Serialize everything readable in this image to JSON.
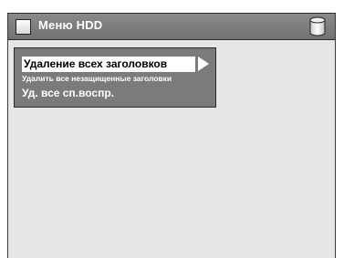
{
  "header": {
    "title": "Меню HDD",
    "left_icon": "menu-icon",
    "right_icon": "hdd-icon"
  },
  "menu": {
    "items": [
      {
        "label": "Удаление всех заголовков",
        "selected": true
      },
      {
        "label": "Удалить все незащищенные заголовки",
        "selected": false
      },
      {
        "label": "Уд. все сп.воспр.",
        "selected": false
      }
    ]
  },
  "colors": {
    "title_bar": "#7f7f7f",
    "panel": "#7b7b7b",
    "background": "#e6e6e6",
    "highlight": "#ffffff"
  }
}
